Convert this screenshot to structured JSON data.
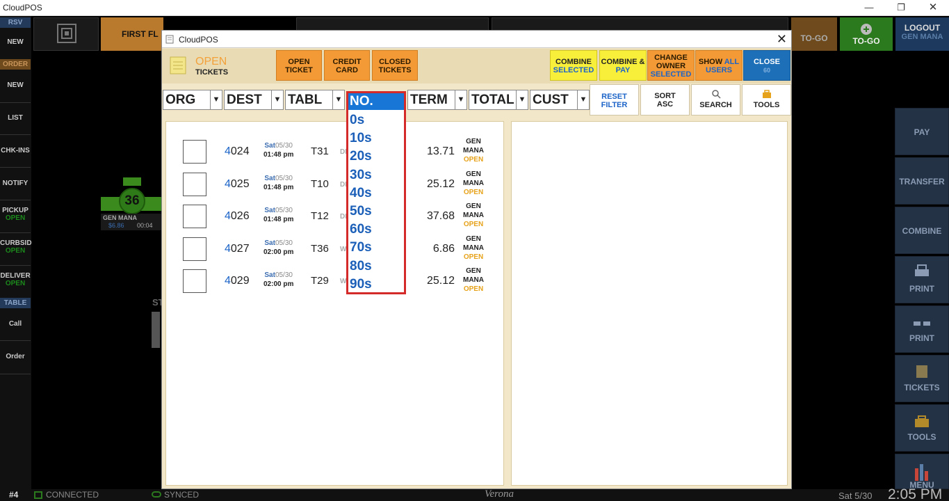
{
  "app": {
    "title": "CloudPOS"
  },
  "sidebar": {
    "hdr_rsv": "RSV",
    "rsv_new": "NEW",
    "hdr_order": "ORDER",
    "order_new": "NEW",
    "list": "LIST",
    "chkins": "CHK-INS",
    "notify": "NOTIFY",
    "pickup": "PICKUP",
    "pickup_sub": "OPEN",
    "curbside": "CURBSID",
    "curbside_sub": "OPEN",
    "delivery": "DELIVER",
    "delivery_sub": "OPEN",
    "hdr_table": "TABLE",
    "call": "Call",
    "order": "Order"
  },
  "toolbar": {
    "floor": "FIRST FL",
    "togo_dim": "TO-GO",
    "togo": "TO-GO",
    "logout": "LOGOUT",
    "logout_user": "GEN MANA"
  },
  "right_col": {
    "pay": "PAY",
    "transfer": "TRANSFER",
    "combine": "COMBINE",
    "print1": "PRINT",
    "print2": "PRINT",
    "tickets": "TICKETS",
    "tools": "TOOLS",
    "menu": "MENU"
  },
  "bg_table": {
    "number": "36",
    "user": "GEN MANA",
    "amount": "$6.86",
    "time": "00:04",
    "st": "ST"
  },
  "status": {
    "station": "#4",
    "connected": "CONNECTED",
    "synced": "SYNCED",
    "location": "Verona",
    "date": "Sat 5/30",
    "time": "2:05 PM"
  },
  "modal": {
    "title": "CloudPOS",
    "header_title": "OPEN",
    "header_sub": "TICKETS",
    "btn_open_ticket": [
      "OPEN",
      "TICKET"
    ],
    "btn_credit_card": [
      "CREDIT",
      "CARD"
    ],
    "btn_closed_tickets": [
      "CLOSED",
      "TICKETS"
    ],
    "btn_combine_selected": [
      "COMBINE",
      "SELECTED"
    ],
    "btn_combine_pay": [
      "COMBINE &",
      "PAY"
    ],
    "btn_change_owner": [
      "CHANGE",
      "OWNER",
      "SELECTED"
    ],
    "btn_show_all": [
      "SHOW ",
      "ALL",
      "USERS"
    ],
    "btn_close": [
      "CLOSE",
      "60"
    ],
    "filters": {
      "org": "ORG",
      "dest": "DEST",
      "tabl": "TABL",
      "term": "TERM",
      "total": "TOTAL",
      "cust": "CUST"
    },
    "reset_filter": [
      "RESET",
      "FILTER"
    ],
    "sort": [
      "SORT",
      "ASC"
    ],
    "search": "SEARCH",
    "tools": "TOOLS"
  },
  "tickets": [
    {
      "first": "4",
      "rest": "024",
      "day": "Sat",
      "date": "05/30",
      "time": "01:48 pm",
      "table": "T31",
      "dest": "DI",
      "total": "13.71",
      "owner1": "GEN",
      "owner2": "MANA",
      "status": "OPEN"
    },
    {
      "first": "4",
      "rest": "025",
      "day": "Sat",
      "date": "05/30",
      "time": "01:48 pm",
      "table": "T10",
      "dest": "DI",
      "total": "25.12",
      "owner1": "GEN",
      "owner2": "MANA",
      "status": "OPEN"
    },
    {
      "first": "4",
      "rest": "026",
      "day": "Sat",
      "date": "05/30",
      "time": "01:48 pm",
      "table": "T12",
      "dest": "DI",
      "total": "37.68",
      "owner1": "GEN",
      "owner2": "MANA",
      "status": "OPEN"
    },
    {
      "first": "4",
      "rest": "027",
      "day": "Sat",
      "date": "05/30",
      "time": "02:00 pm",
      "table": "T36",
      "dest": "W",
      "total": "6.86",
      "owner1": "GEN",
      "owner2": "MANA",
      "status": "OPEN"
    },
    {
      "first": "4",
      "rest": "029",
      "day": "Sat",
      "date": "05/30",
      "time": "02:00 pm",
      "table": "T29",
      "dest": "W",
      "total": "25.12",
      "owner1": "GEN",
      "owner2": "MANA",
      "status": "OPEN"
    }
  ],
  "dropdown": {
    "selected": "NO.",
    "options": [
      "0s",
      "10s",
      "20s",
      "30s",
      "40s",
      "50s",
      "60s",
      "70s",
      "80s",
      "90s"
    ]
  }
}
